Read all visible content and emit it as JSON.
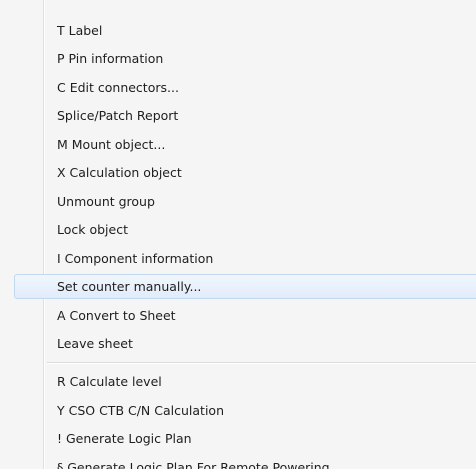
{
  "menu": {
    "items": [
      {
        "label": "T Label"
      },
      {
        "label": "P Pin information"
      },
      {
        "label": "C Edit connectors..."
      },
      {
        "label": "Splice/Patch Report"
      },
      {
        "label": "M Mount object..."
      },
      {
        "label": "X Calculation object"
      },
      {
        "label": "Unmount group"
      },
      {
        "label": "Lock object"
      },
      {
        "label": "I Component information"
      },
      {
        "label": "Set counter manually..."
      },
      {
        "label": "A Convert to Sheet"
      },
      {
        "label": "Leave sheet"
      },
      {
        "label": "R Calculate level"
      },
      {
        "label": "Y CSO CTB C/N Calculation"
      },
      {
        "label": "! Generate Logic Plan"
      },
      {
        "label": "§ Generate Logic Plan For Remote Powering"
      }
    ],
    "highlighted_item": "Set counter manually..."
  }
}
